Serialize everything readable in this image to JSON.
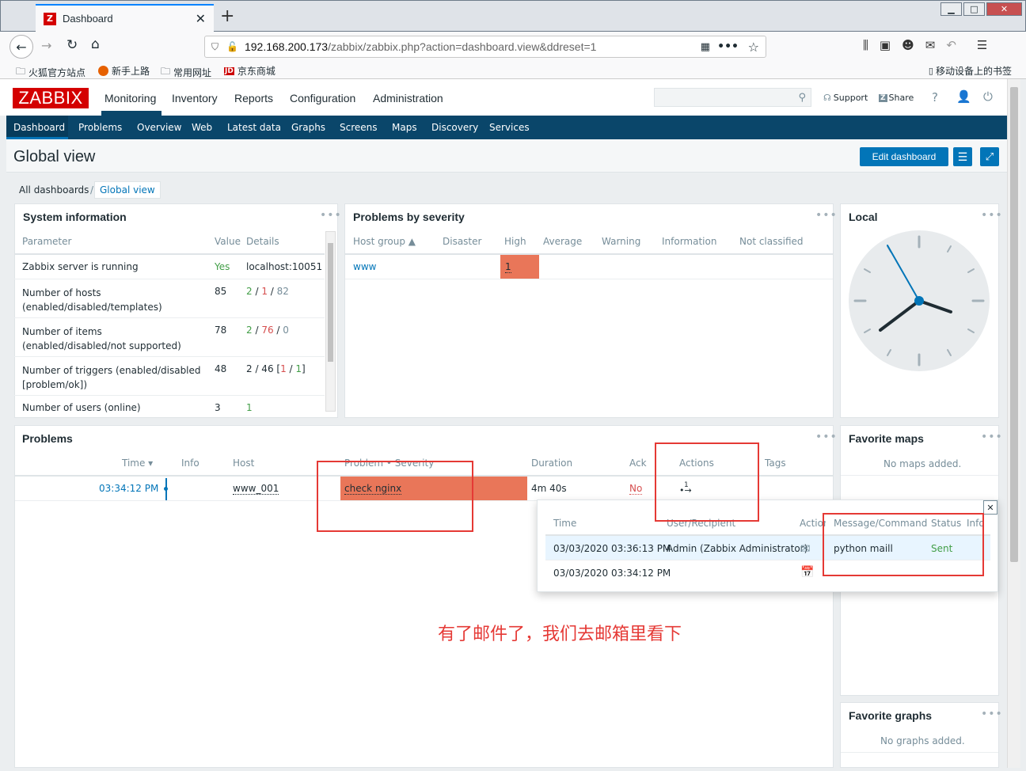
{
  "browser": {
    "tab_title": "Dashboard",
    "url_host": "192.168.200.173",
    "url_path": "/zabbix/zabbix.php?action=dashboard.view&ddreset=1",
    "bookmarks": [
      "火狐官方站点",
      "新手上路",
      "常用网址",
      "京东商城"
    ],
    "mobile_bookmarks": "移动设备上的书签"
  },
  "zabbix": {
    "logo": "ZABBIX",
    "menu": [
      "Monitoring",
      "Inventory",
      "Reports",
      "Configuration",
      "Administration"
    ],
    "support": "Support",
    "share": "Share",
    "help": "?",
    "submenu": [
      "Dashboard",
      "Problems",
      "Overview",
      "Web",
      "Latest data",
      "Graphs",
      "Screens",
      "Maps",
      "Discovery",
      "Services"
    ],
    "page_title": "Global view",
    "edit_dashboard": "Edit dashboard",
    "breadcrumb": [
      "All dashboards",
      "Global view"
    ]
  },
  "sysinfo": {
    "title": "System information",
    "headers": [
      "Parameter",
      "Value",
      "Details"
    ],
    "rows": [
      {
        "param": "Zabbix server is running",
        "value": "Yes",
        "details": "localhost:10051"
      },
      {
        "param": "Number of hosts (enabled/disabled/templates)",
        "value": "85",
        "d1": "2",
        "d2": "1",
        "d3": "82"
      },
      {
        "param": "Number of items (enabled/disabled/not supported)",
        "value": "78",
        "d1": "2",
        "d2": "76",
        "d3": "0"
      },
      {
        "param": "Number of triggers (enabled/disabled [problem/ok])",
        "value": "48",
        "d1": "2 / 46 [",
        "d2": "1",
        "d3": "1"
      },
      {
        "param": "Number of users (online)",
        "value": "3",
        "details": "1"
      }
    ]
  },
  "severity": {
    "title": "Problems by severity",
    "headers": [
      "Host group ▲",
      "Disaster",
      "High",
      "Average",
      "Warning",
      "Information",
      "Not classified"
    ],
    "row": {
      "group": "www",
      "high": "1"
    }
  },
  "clock": {
    "title": "Local"
  },
  "problems": {
    "title": "Problems",
    "headers": [
      "Time ▾",
      "Info",
      "Host",
      "Problem • Severity",
      "Duration",
      "Ack",
      "Actions",
      "Tags"
    ],
    "row": {
      "time": "03:34:12 PM",
      "host": "www_001",
      "problem": "check nginx",
      "duration": "4m 40s",
      "ack": "No",
      "actions": "1"
    }
  },
  "popup": {
    "headers": [
      "Time",
      "User/Recipient",
      "Action",
      "Message/Command",
      "Status",
      "Info"
    ],
    "rows": [
      {
        "time": "03/03/2020 03:36:13 PM",
        "user": "Admin (Zabbix Administrator)",
        "message": "python maill",
        "status": "Sent"
      },
      {
        "time": "03/03/2020 03:34:12 PM",
        "user": "",
        "message": "",
        "status": ""
      }
    ]
  },
  "maps": {
    "title": "Favorite maps",
    "empty": "No maps added."
  },
  "graphs": {
    "title": "Favorite graphs",
    "empty": "No graphs added."
  },
  "annotation": "有了邮件了，我们去邮箱里看下"
}
